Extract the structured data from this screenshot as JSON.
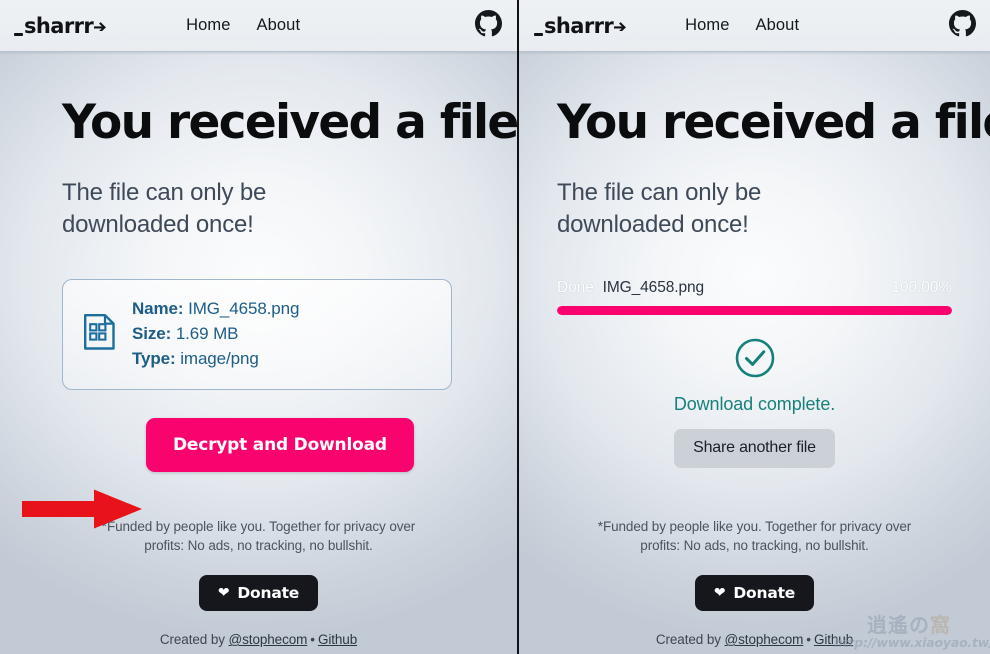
{
  "nav": {
    "logo_text": "sharrr",
    "logo_icon": "arrow-right-glyph",
    "links": [
      {
        "label": "Home"
      },
      {
        "label": "About"
      }
    ],
    "github_icon": "github-icon"
  },
  "left_panel": {
    "headline": "You received a file",
    "subhead_line1": "The file can only be",
    "subhead_line2": "downloaded once!",
    "file_icon": "binary-file-icon",
    "file_icon_digits_top": "01",
    "file_icon_digits_bottom": "10",
    "file": {
      "name_label": "Name:",
      "name_value": "IMG_4658.png",
      "size_label": "Size:",
      "size_value": "1.69 MB",
      "type_label": "Type:",
      "type_value": "image/png"
    },
    "primary_button": "Decrypt and Download",
    "annotation_arrow": "red-arrow-annotation"
  },
  "right_panel": {
    "headline": "You received a file",
    "subhead_line1": "The file can only be",
    "subhead_line2": "downloaded once!",
    "progress": {
      "status": "Done",
      "filename": "IMG_4658.png",
      "percent_label": "100.00%",
      "percent_value": 100
    },
    "success_icon": "check-circle-icon",
    "complete_text": "Download complete.",
    "share_button": "Share another file"
  },
  "footer": {
    "note_line1": "*Funded by people like you. Together for privacy over",
    "note_line2": "profits: No ads, no tracking, no bullshit.",
    "donate_icon": "heart-icon",
    "donate_label": "Donate",
    "created_by_prefix": "Created by ",
    "author_handle": "@stophecom",
    "separator": "•",
    "github_link": "Github"
  },
  "watermark": {
    "title_a": "逍遙",
    "title_b": "の",
    "title_c": "窩",
    "url": "http://www.xiaoyao.tw/"
  },
  "colors": {
    "accent_pink": "#f9046e",
    "teal": "#17807a",
    "file_blue": "#1d5d86",
    "dark": "#15171c",
    "annotation_red": "#e8121a"
  }
}
